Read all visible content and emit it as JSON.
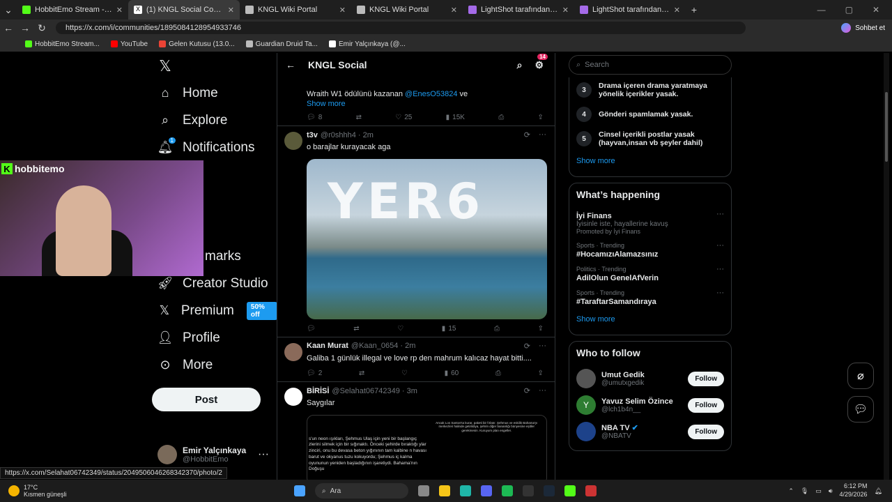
{
  "tabs": [
    {
      "title": "HobbitEmo Stream - Watch Live o",
      "color": "#53fc18",
      "active": false
    },
    {
      "title": "(1) KNGL Social Community / X",
      "color": "#000",
      "active": true
    },
    {
      "title": "KNGL Wiki Portal",
      "color": "#aaa",
      "active": false
    },
    {
      "title": "KNGL Wiki Portal",
      "color": "#aaa",
      "active": false
    },
    {
      "title": "LightShot tarafından Ekran Görünt",
      "color": "#a46ae8",
      "active": false
    },
    {
      "title": "LightShot tarafından Ekran Görünt",
      "color": "#a46ae8",
      "active": false
    }
  ],
  "url": "https://x.com/i/communities/1895084128954933746",
  "profile_button": "Sohbet et",
  "bookmarks": [
    {
      "label": "HobbitEmo Stream...",
      "color": "#53fc18"
    },
    {
      "label": "YouTube",
      "color": "#ff0000"
    },
    {
      "label": "Gelen Kutusu (13.0...",
      "color": "#ea4335"
    },
    {
      "label": "Guardian Druid Ta...",
      "color": "#bbb"
    },
    {
      "label": "Emir Yalçınkaya (@...",
      "color": "#fff"
    }
  ],
  "nav": {
    "home": "Home",
    "explore": "Explore",
    "notifications": "Notifications",
    "notif_badge": "1",
    "bookmarks": "marks",
    "creator": "Creator Studio",
    "premium": "Premium",
    "premium_badge": "50% off",
    "profile": "Profile",
    "more": "More",
    "post": "Post"
  },
  "webcam_brand": "hobbitemo",
  "me": {
    "name": "Emir Yalçınkaya",
    "handle": "@HobbitEmo"
  },
  "community": {
    "title": "KNGL Social",
    "gear_badge": "14"
  },
  "posts": [
    {
      "text_pre": "Wraith W1 ödülünü kazanan ",
      "mention": "@EnesO53824",
      "text_post": " ve",
      "show_more": "Show more",
      "replies": "8",
      "likes": "25",
      "views": "15K"
    },
    {
      "name": "t3v",
      "handle": "@r0shhh4 · 2m",
      "text": "o barajlar kurayacak aga",
      "image_text": "YER6",
      "replies": "",
      "likes": "",
      "views": "15"
    },
    {
      "name": "Kaan Murat",
      "handle": "@Kaan_0654 · 2m",
      "text": "Galiba 1 günlük illegal ve love rp den mahrum kalıcaz hayat bitti....",
      "replies": "2",
      "likes": "",
      "views": "60"
    },
    {
      "name": "BİRİSİ",
      "handle": "@Selahat06742349 · 3m",
      "text": "Saygılar",
      "img_left": "s'un neon ışıkları, Şehmus Ulaş için yeni bir başlangıç zlerini silmek için bir sığınaktı. Önceki şehirde bıraktığı ylar zinciri, onu bu devasa beton yığınının tam kalbine n havası barut ve okyanus tuzu kokuyordu; Şehmus iç kalma oyununun yeniden başladığının işaretiydi. Bahama'nın Doğuşu",
      "img_right": "Ancak Los Santos'ta kurar, paketi bir fırlatır. Şehmus ve eskilik Bahama'yı merkezleri halinde getirildiya, şehrin diğer bananlığı bünyesine eşitler gerekmesin. Kuruyum plan engeller."
    }
  ],
  "search_placeholder": "Search",
  "rules": [
    {
      "n": "3",
      "text": "Drama içeren drama yaratmaya yönelik içerikler yasak."
    },
    {
      "n": "4",
      "text": "Gönderi spamlamak yasak."
    },
    {
      "n": "5",
      "text": "Cinsel içerikli postlar yasak (hayvan,insan vb şeyler dahil)"
    }
  ],
  "show_more": "Show more",
  "happening": {
    "title": "What’s happening",
    "items": [
      {
        "meta": "",
        "tag": "İyi Finans",
        "sub": "İyisinle iste, hayallerine kavuş",
        "promoted": "Promoted by İyi Finans"
      },
      {
        "meta": "Sports · Trending",
        "tag": "#HocamızıAlamazsınız"
      },
      {
        "meta": "Politics · Trending",
        "tag": "AdilOlun GenelAfVerin"
      },
      {
        "meta": "Sports · Trending",
        "tag": "#TaraftarSamandıraya"
      }
    ]
  },
  "whotofollow": {
    "title": "Who to follow",
    "follow_label": "Follow",
    "items": [
      {
        "name": "Umut Gedik",
        "handle": "@umutxgedik",
        "color": "#555"
      },
      {
        "name": "Yavuz Selim Özince",
        "handle": "@lch1b4n__",
        "color": "#2e7d32",
        "initial": "Y"
      },
      {
        "name": "NBA TV",
        "handle": "@NBATV",
        "color": "#1d428a"
      }
    ]
  },
  "status_url": "https://x.com/Selahat06742349/status/2049506046268342370/photo/2",
  "weather": {
    "temp": "17°C",
    "desc": "Kısmen güneşli"
  },
  "taskbar_search": "Ara",
  "clock": {
    "time": "6:12 PM",
    "date": "4/29/2026"
  }
}
